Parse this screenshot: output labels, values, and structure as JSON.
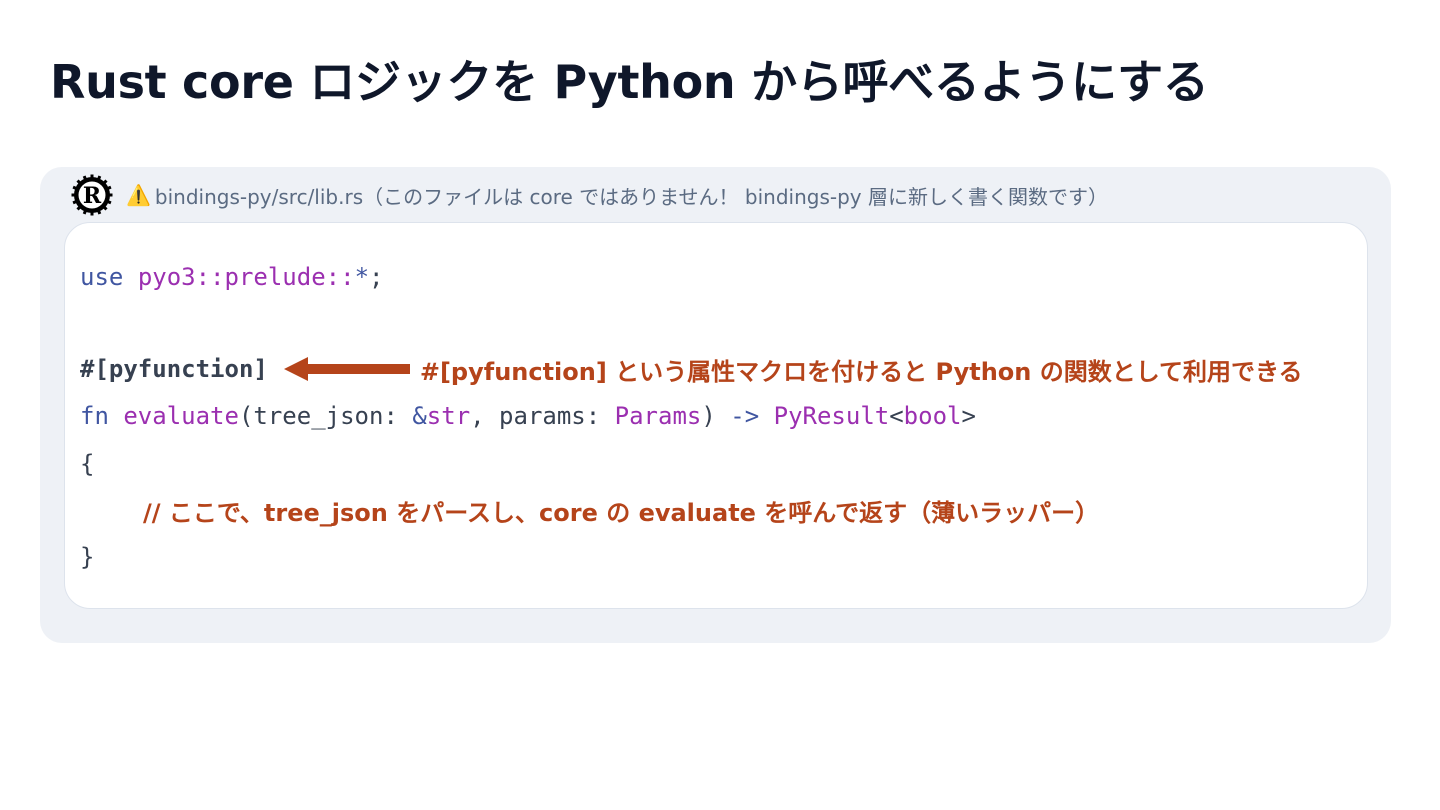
{
  "slide": {
    "title": "Rust core ロジックを Python から呼べるようにする"
  },
  "panel": {
    "logo_icon": "rust-logo-icon",
    "warning_icon": "⚠️",
    "file_label": "bindings-py/src/lib.rs（このファイルは core ではありません！ bindings-py 層に新しく書く関数です）"
  },
  "code": {
    "line1": {
      "kw": "use",
      "path": "pyo3::prelude::",
      "star": "*",
      "semi": ";"
    },
    "attribute": "#[pyfunction]",
    "annotation": "#[pyfunction] という属性マクロを付けると Python の関数として利用できる",
    "line3": {
      "fn": "fn",
      "name": "evaluate",
      "open_paren": "(tree_json: ",
      "amp": "&",
      "str": "str",
      "mid": ", params: ",
      "params_type": "Params",
      "close_paren": ") ",
      "arrow": "->",
      "ret": "PyResult",
      "lt": "<",
      "bool": "bool",
      "gt": ">"
    },
    "open_brace": "{",
    "comment": "// ここで、tree_json をパースし、core の evaluate を呼んで返す（薄いラッパー）",
    "close_brace": "}"
  },
  "colors": {
    "title": "#0f172a",
    "panel_bg": "#eef1f6",
    "file_label": "#5b6b82",
    "keyword": "#4056a1",
    "identifier": "#9b2fb0",
    "annotation": "#b5441a"
  }
}
